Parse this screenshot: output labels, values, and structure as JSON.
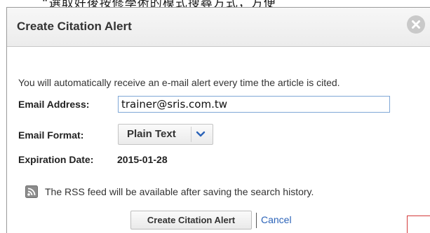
{
  "background": {
    "text_fragment": "“選取好後按修學術的模式搜尋方式，方便"
  },
  "dialog": {
    "title": "Create Citation Alert",
    "close_icon": "close-icon"
  },
  "form": {
    "info_text": "You will automatically receive an e-mail alert every time the article is cited.",
    "email_label": "Email Address:",
    "email_value": "trainer@sris.com.tw",
    "format_label": "Email Format:",
    "format_selected": "Plain Text",
    "expiration_label": "Expiration Date:",
    "expiration_value": "2015-01-28",
    "rss_icon": "rss-feed-icon",
    "rss_text": "The RSS feed will be available after saving the search history."
  },
  "actions": {
    "create_label": "Create Citation Alert",
    "cancel_label": "Cancel"
  },
  "colors": {
    "link": "#2b63b8",
    "input_border": "#7fa7d6",
    "annotation": "#d43a3a"
  }
}
